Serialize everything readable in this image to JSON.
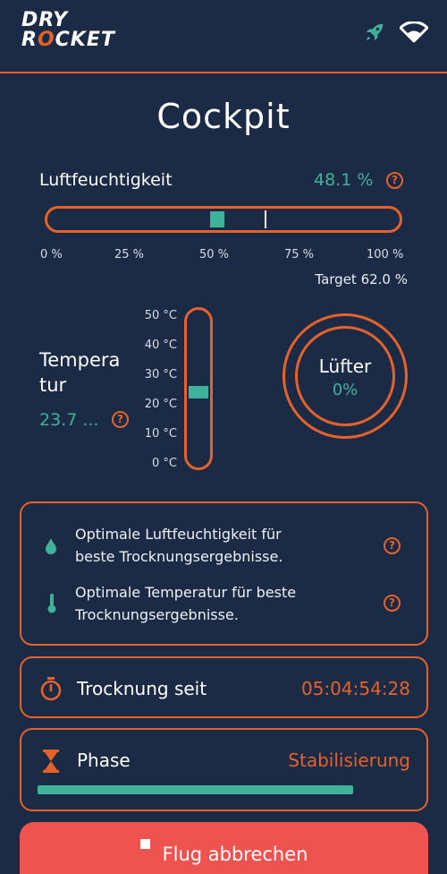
{
  "header": {
    "logo_line1": "DRY",
    "logo_line2_a": "R",
    "logo_line2_o": "O",
    "logo_line2_b": "CKET",
    "icons": [
      "rocket-icon",
      "wifi-icon"
    ],
    "accent": "#e6622a"
  },
  "page_title": "Cockpit",
  "humidity": {
    "label": "Luftfeuchtigkeit",
    "value": "48.1 %",
    "value_fraction": 0.481,
    "target_fraction": 0.62,
    "ticks": [
      "0 %",
      "25 %",
      "50 %",
      "75 %",
      "100 %"
    ],
    "target_text": "Target 62.0 %"
  },
  "temperature": {
    "label_line1": "Tempera",
    "label_line2": "tur",
    "value": "23.7 ...",
    "ticks": [
      "50 °C",
      "40 °C",
      "30 °C",
      "20 °C",
      "10 °C",
      "0 °C"
    ],
    "value_c": 23.7
  },
  "fan": {
    "label": "Lüfter",
    "value": "0%"
  },
  "info": {
    "humidity_line1": "Optimale Luftfeuchtigkeit für",
    "humidity_line2": "beste Trocknungsergebnisse.",
    "temperature_line1": "Optimale Temperatur für beste",
    "temperature_line2": "Trocknungsergebnisse."
  },
  "drying": {
    "label": "Trocknung seit",
    "value": "05:04:54:28"
  },
  "phase": {
    "label": "Phase",
    "value": "Stabilisierung",
    "progress_fraction": 0.84
  },
  "abort_button": {
    "label": "Flug abbrechen"
  },
  "colors": {
    "background": "#1b2a45",
    "teal": "#3fb39a",
    "orange": "#e6622a",
    "danger": "#ef5350"
  }
}
